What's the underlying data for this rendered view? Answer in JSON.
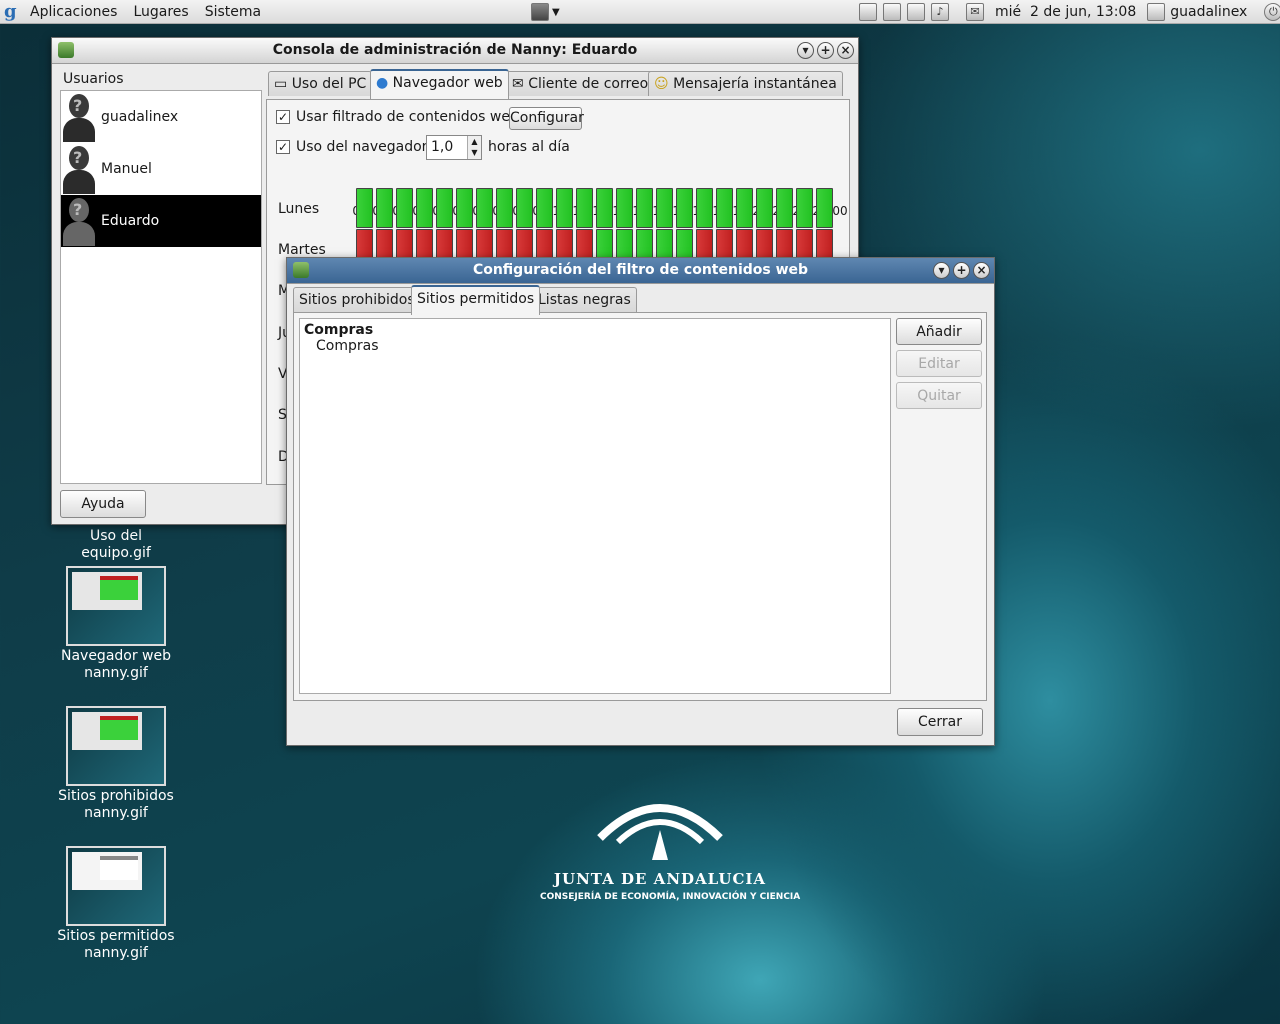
{
  "panel": {
    "menus": [
      "Aplicaciones",
      "Lugares",
      "Sistema"
    ],
    "clock": "mié  2 de jun, 13:08",
    "user": "guadalinex"
  },
  "desktop_icons": [
    {
      "line1": "Uso del equipo.gif",
      "line2": ""
    },
    {
      "line1": "Navegador web",
      "line2": "nanny.gif"
    },
    {
      "line1": "Sitios prohibidos",
      "line2": "nanny.gif"
    },
    {
      "line1": "Sitios permitidos",
      "line2": "nanny.gif"
    }
  ],
  "logo": {
    "line1": "JUNTA DE ANDALUCIA",
    "line2": "CONSEJERÍA DE ECONOMÍA, INNOVACIÓN Y CIENCIA"
  },
  "nanny": {
    "title": "Consola de administración de Nanny: Eduardo",
    "users_label": "Usuarios",
    "users": [
      "guadalinex",
      "Manuel",
      "Eduardo"
    ],
    "selected_user": "Eduardo",
    "tabs": [
      "Uso del PC",
      "Navegador web",
      "Cliente de correo",
      "Mensajería instantánea"
    ],
    "active_tab": "Navegador web",
    "filter_checkbox": "Usar filtrado de contenidos web",
    "filter_checked": true,
    "config_button": "Configurar",
    "usage_checkbox": "Uso del navegador",
    "usage_checked": true,
    "usage_value": "1,0",
    "usage_unit": "horas al día",
    "hours": [
      "00",
      "01",
      "02",
      "03",
      "04",
      "05",
      "06",
      "07",
      "08",
      "09",
      "10",
      "11",
      "12",
      "13",
      "14",
      "15",
      "16",
      "17",
      "18",
      "19",
      "20",
      "21",
      "22",
      "23",
      "00"
    ],
    "days": [
      "Lunes",
      "Martes",
      "M",
      "Ju",
      "V",
      "S",
      "D"
    ],
    "schedule": {
      "lunes": "gggggggggggggggggggggggg",
      "martes": "rrrrrrrrrrrrgggggrrrrrrr"
    },
    "help_button": "Ayuda"
  },
  "filter_dialog": {
    "title": "Configuración del filtro de contenidos web",
    "tabs": [
      "Sitios prohibidos",
      "Sitios permitidos",
      "Listas negras"
    ],
    "active_tab": "Sitios permitidos",
    "category": "Compras",
    "items": [
      "Compras"
    ],
    "add_button": "Añadir",
    "edit_button": "Editar",
    "remove_button": "Quitar",
    "close_button": "Cerrar"
  }
}
